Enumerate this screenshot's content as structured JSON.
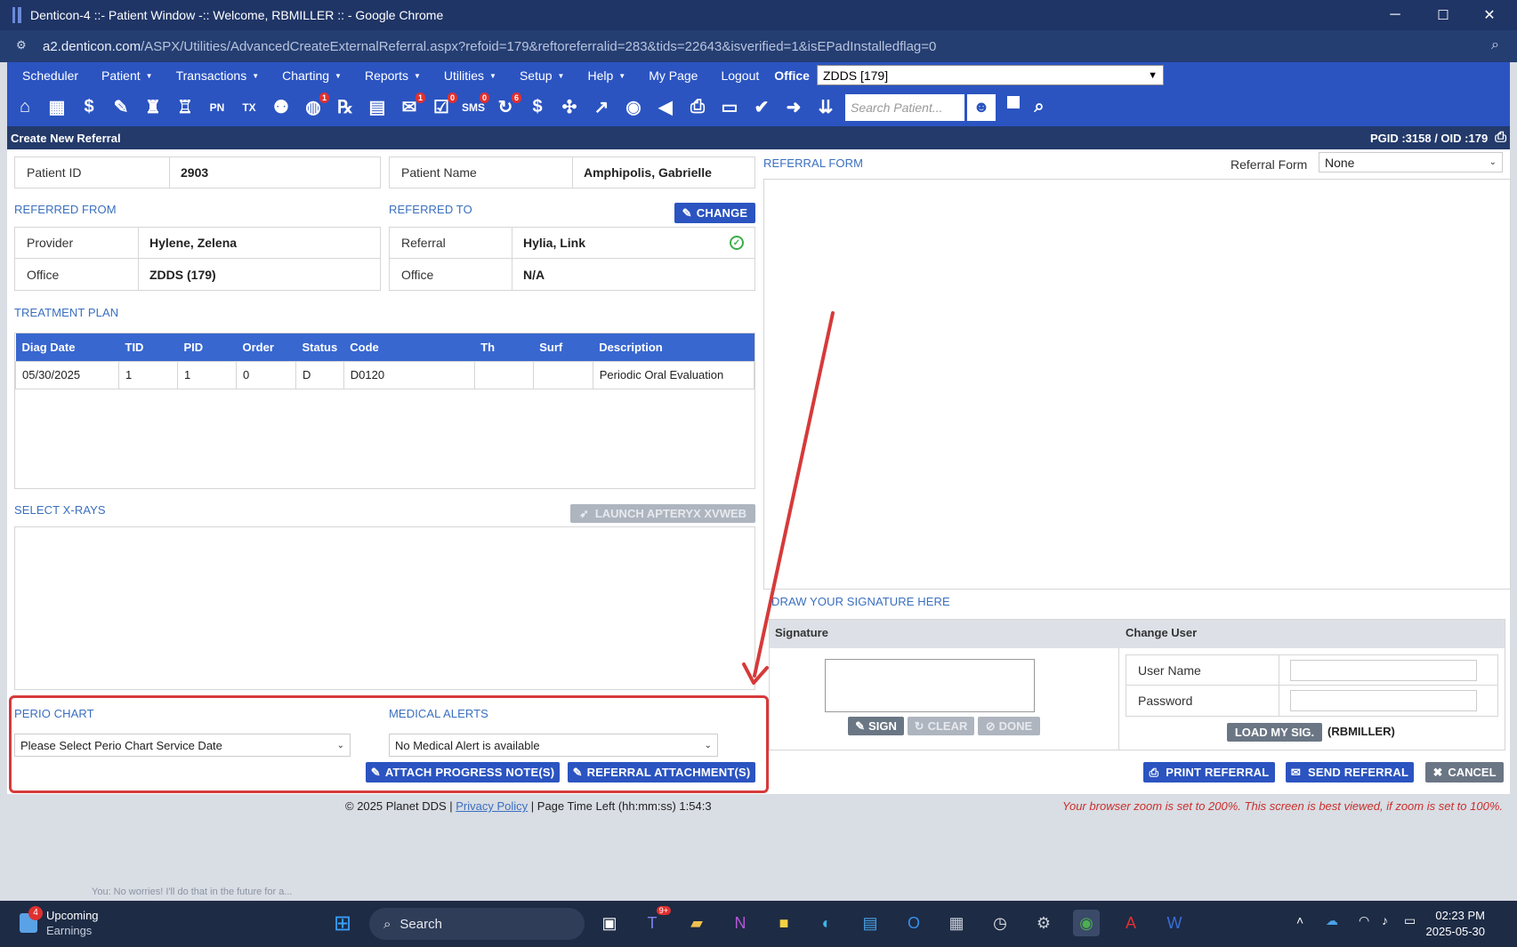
{
  "window": {
    "title": "Denticon-4 ::- Patient Window -:: Welcome, RBMILLER :: - Google Chrome",
    "minimize": "─",
    "maximize": "☐",
    "close": "✕"
  },
  "address": {
    "host": "a2.denticon.com",
    "path": "/ASPX/Utilities/AdvancedCreateExternalReferral.aspx?refoid=179&reftoreferralid=283&tids=22643&isverified=1&isEPadInstalledflag=0"
  },
  "menu": {
    "items": [
      {
        "label": "Scheduler",
        "caret": false
      },
      {
        "label": "Patient",
        "caret": true
      },
      {
        "label": "Transactions",
        "caret": true
      },
      {
        "label": "Charting",
        "caret": true
      },
      {
        "label": "Reports",
        "caret": true
      },
      {
        "label": "Utilities",
        "caret": true
      },
      {
        "label": "Setup",
        "caret": true
      },
      {
        "label": "Help",
        "caret": true
      },
      {
        "label": "My Page",
        "caret": false
      },
      {
        "label": "Logout",
        "caret": false
      }
    ],
    "office_label": "Office",
    "office_value": "ZDDS [179]"
  },
  "toolbar": {
    "search_placeholder": "Search Patient...",
    "icons": [
      {
        "name": "home-icon",
        "glyph": "⌂",
        "badge": ""
      },
      {
        "name": "calendar-icon",
        "glyph": "▦",
        "badge": ""
      },
      {
        "name": "dollar-icon",
        "glyph": "$",
        "badge": ""
      },
      {
        "name": "edit-notes-icon",
        "glyph": "✎",
        "badge": ""
      },
      {
        "name": "tooth-chart-icon",
        "glyph": "♜",
        "badge": ""
      },
      {
        "name": "perio-icon",
        "glyph": "♖",
        "badge": ""
      },
      {
        "name": "pn-icon",
        "glyph": "PN",
        "badge": ""
      },
      {
        "name": "tx-icon",
        "glyph": "TX",
        "badge": ""
      },
      {
        "name": "add-patient-icon",
        "glyph": "⚉",
        "badge": ""
      },
      {
        "name": "globe-user-icon",
        "glyph": "◍",
        "badge": "1"
      },
      {
        "name": "rx-icon",
        "glyph": "℞",
        "badge": ""
      },
      {
        "name": "chat-icon",
        "glyph": "▤",
        "badge": ""
      },
      {
        "name": "message-icon",
        "glyph": "✉",
        "badge": "1"
      },
      {
        "name": "task-icon",
        "glyph": "☑",
        "badge": "0"
      },
      {
        "name": "sms-icon",
        "glyph": "SMS",
        "badge": "0"
      },
      {
        "name": "recall-icon",
        "glyph": "↻",
        "badge": "6"
      },
      {
        "name": "insurance-icon",
        "glyph": "$",
        "badge": ""
      },
      {
        "name": "network-icon",
        "glyph": "✣",
        "badge": ""
      },
      {
        "name": "chart-line-icon",
        "glyph": "↗",
        "badge": ""
      },
      {
        "name": "user-circle-icon",
        "glyph": "◉",
        "badge": ""
      },
      {
        "name": "megaphone-icon",
        "glyph": "◀",
        "badge": ""
      },
      {
        "name": "printer-icon",
        "glyph": "⎙",
        "badge": ""
      },
      {
        "name": "document-icon",
        "glyph": "▭",
        "badge": ""
      },
      {
        "name": "shield-check-icon",
        "glyph": "✔",
        "badge": ""
      },
      {
        "name": "arrow-right-icon",
        "glyph": "➜",
        "badge": ""
      },
      {
        "name": "double-chevron-icon",
        "glyph": "⇊",
        "badge": ""
      }
    ]
  },
  "page_header": {
    "title": "Create New Referral",
    "ids": "PGID :3158  /  OID :179"
  },
  "patient": {
    "id_label": "Patient ID",
    "id_value": "2903",
    "name_label": "Patient Name",
    "name_value": "Amphipolis, Gabrielle"
  },
  "referred_from": {
    "title": "REFERRED FROM",
    "provider_label": "Provider",
    "provider_value": "Hylene, Zelena",
    "office_label": "Office",
    "office_value": "ZDDS (179)"
  },
  "referred_to": {
    "title": "REFERRED TO",
    "change_label": "CHANGE",
    "referral_label": "Referral",
    "referral_value": "Hylia, Link",
    "office_label": "Office",
    "office_value": "N/A"
  },
  "treatment_plan": {
    "title": "TREATMENT PLAN",
    "columns": [
      "Diag Date",
      "TID",
      "PID",
      "Order",
      "Status",
      "Code",
      "Th",
      "Surf",
      "Description"
    ],
    "rows": [
      [
        "05/30/2025",
        "1",
        "1",
        "0",
        "D",
        "D0120",
        "",
        "",
        "Periodic Oral Evaluation"
      ]
    ]
  },
  "xrays": {
    "title": "SELECT X-RAYS",
    "launch_label": "LAUNCH APTERYX XVWEB"
  },
  "perio": {
    "title": "PERIO CHART",
    "select_value": "Please Select Perio Chart Service Date"
  },
  "medical": {
    "title": "MEDICAL ALERTS",
    "select_value": "No Medical Alert is available"
  },
  "buttons": {
    "attach_progress": "ATTACH PROGRESS NOTE(S)",
    "referral_attachments": "REFERRAL ATTACHMENT(S)",
    "print": "PRINT REFERRAL",
    "send": "SEND REFERRAL",
    "cancel": "CANCEL"
  },
  "referral_form": {
    "title": "REFERRAL FORM",
    "select_label": "Referral Form",
    "select_value": "None"
  },
  "signature": {
    "title": "DRAW YOUR SIGNATURE HERE",
    "col_signature": "Signature",
    "col_change_user": "Change User",
    "sign": "SIGN",
    "clear": "CLEAR",
    "done": "DONE",
    "username_label": "User Name",
    "password_label": "Password",
    "load_sig": "LOAD MY SIG.",
    "current_user": "(RBMILLER)"
  },
  "footer": {
    "copyright": "© 2025 Planet DDS | ",
    "privacy": "Privacy Policy",
    "time_left": " | Page Time Left (hh:mm:ss) 1:54:3",
    "zoom_warning": "Your browser zoom is set to 200%. This screen is best viewed, if zoom is set to 100%."
  },
  "taskbar": {
    "weather_badge": "4",
    "weather_line1": "Upcoming",
    "weather_line2": "Earnings",
    "search": "Search",
    "teams_badge": "9+",
    "time": "02:23 PM",
    "date": "2025-05-30",
    "hidden_chat": "You: No worries! I'll do that in the future for a..."
  },
  "colors": {
    "accent": "#2b54c1",
    "section_title": "#3a6fbf",
    "annotation_red": "#d63a3a",
    "success_green": "#3cae4a"
  }
}
